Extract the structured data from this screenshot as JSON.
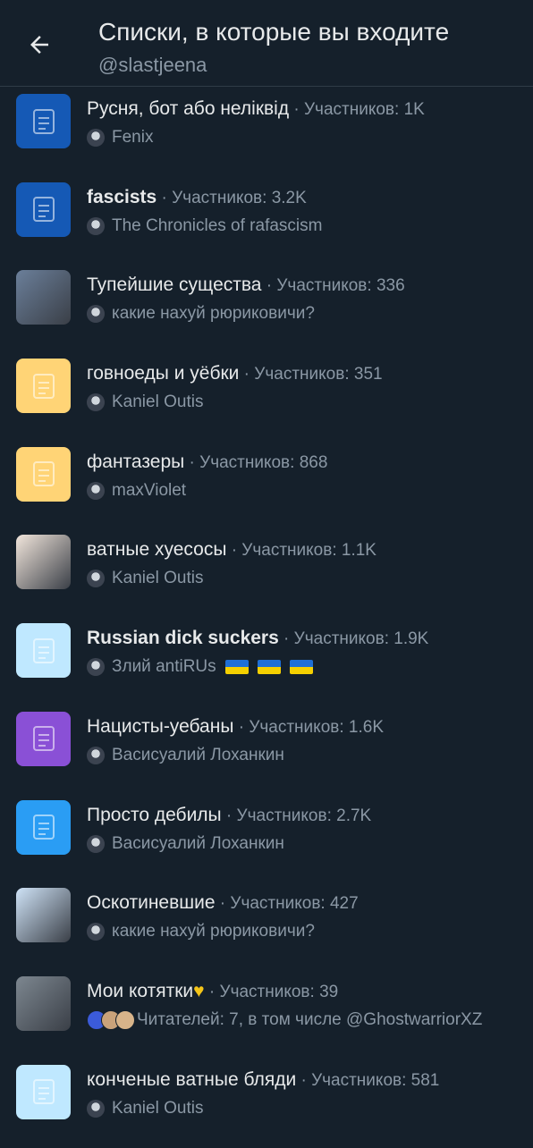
{
  "header": {
    "title": "Списки, в которые вы входите",
    "subtitle": "@slastjeena"
  },
  "lists": [
    {
      "name": "Русня, бот або неліквід",
      "members": " · Участников: 1K",
      "owner": "Fenix",
      "thumb": "#1559b5",
      "icon": "list-icon"
    },
    {
      "name": "fascists",
      "members": " · Участников: 3.2K",
      "owner": "The Chronicles of rafascism",
      "thumb": "#1559b5",
      "icon": "list-icon",
      "bold": true
    },
    {
      "name": "Тупейшие существа",
      "members": " · Участников: 336",
      "owner": "какие нахуй рюриковичи?",
      "thumb": "#6b7f9a",
      "icon": "photo"
    },
    {
      "name": "говноеды и уёбки",
      "members": " · Участников: 351",
      "owner": "Kaniel Outis",
      "thumb": "#ffd476",
      "icon": "list-icon"
    },
    {
      "name": "фантазеры",
      "members": " · Участников: 868",
      "owner": "maxViolet",
      "thumb": "#ffd476",
      "icon": "list-icon"
    },
    {
      "name": "ватные хуесосы",
      "members": " · Участников: 1.1K",
      "owner": "Kaniel Outis",
      "thumb": "#f2e6dc",
      "icon": "photo"
    },
    {
      "name": "Russian dick suckers",
      "members": " · Участников: 1.9K",
      "owner": "Злий antiRUs",
      "thumb": "#bfe8ff",
      "icon": "list-icon",
      "bold": true,
      "flags": 3
    },
    {
      "name": "Нацисты-уебаны",
      "members": " · Участников: 1.6K",
      "owner": "Васисуалий Лоханкин",
      "thumb": "#8a50d6",
      "icon": "list-icon"
    },
    {
      "name": "Просто дебилы",
      "members": " · Участников: 2.7K",
      "owner": "Васисуалий Лоханкин",
      "thumb": "#2a9df4",
      "icon": "list-icon"
    },
    {
      "name": "Оскотиневшие",
      "members": " · Участников: 427",
      "owner": "какие нахуй рюриковичи?",
      "thumb": "#cfe3f7",
      "icon": "photo"
    },
    {
      "name": "Мои котятки",
      "members": " · Участников: 39",
      "owner": "Читателей: 7, в том числе @GhostwarriorXZ",
      "thumb": "#7d8790",
      "icon": "photo",
      "heart": true,
      "followers": true
    },
    {
      "name": "конченые ватные бляди",
      "members": " · Участников: 581",
      "owner": "Kaniel Outis",
      "thumb": "#bfe8ff",
      "icon": "list-icon"
    }
  ]
}
